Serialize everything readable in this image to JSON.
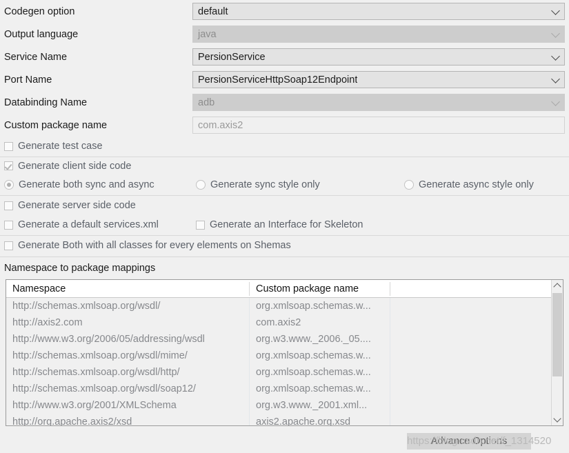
{
  "form": {
    "rows": [
      {
        "label": "Codegen option",
        "value": "default",
        "control": "combo",
        "disabled": false
      },
      {
        "label": "Output language",
        "value": "java",
        "control": "combo",
        "disabled": true
      },
      {
        "label": "Service Name",
        "value": "PersionService",
        "control": "combo",
        "disabled": false
      },
      {
        "label": "Port Name",
        "value": "PersionServiceHttpSoap12Endpoint",
        "control": "combo",
        "disabled": false
      },
      {
        "label": "Databinding Name",
        "value": "adb",
        "control": "combo",
        "disabled": true
      },
      {
        "label": "Custom package name",
        "value": "com.axis2",
        "control": "textfield",
        "disabled": false
      }
    ]
  },
  "options": {
    "test_case": {
      "label": "Generate test case",
      "checked": false
    },
    "client_side": {
      "label": "Generate client side code",
      "checked": true
    },
    "radio_both": {
      "label": "Generate both sync and async",
      "selected": true
    },
    "radio_sync": {
      "label": "Generate sync style only",
      "selected": false
    },
    "radio_async": {
      "label": "Generate async style only",
      "selected": false
    },
    "server_side": {
      "label": "Generate server side code",
      "checked": false
    },
    "services_xml": {
      "label": "Generate a default services.xml",
      "checked": false
    },
    "interface_skel": {
      "label": "Generate an Interface for Skeleton",
      "checked": false
    },
    "both_all_classes": {
      "label": "Generate Both with all classes for every elements on Shemas",
      "checked": false
    }
  },
  "table": {
    "title": "Namespace to package mappings",
    "columns": [
      "Namespace",
      "Custom package name",
      ""
    ],
    "rows": [
      [
        "http://schemas.xmlsoap.org/wsdl/",
        "org.xmlsoap.schemas.w...",
        ""
      ],
      [
        "http://axis2.com",
        "com.axis2",
        ""
      ],
      [
        "http://www.w3.org/2006/05/addressing/wsdl",
        "org.w3.www._2006._05....",
        ""
      ],
      [
        "http://schemas.xmlsoap.org/wsdl/mime/",
        "org.xmlsoap.schemas.w...",
        ""
      ],
      [
        "http://schemas.xmlsoap.org/wsdl/http/",
        "org.xmlsoap.schemas.w...",
        ""
      ],
      [
        "http://schemas.xmlsoap.org/wsdl/soap12/",
        "org.xmlsoap.schemas.w...",
        ""
      ],
      [
        "http://www.w3.org/2001/XMLSchema",
        "org.w3.www._2001.xml...",
        ""
      ],
      [
        "http://org.apache.axis2/xsd",
        "axis2.apache.org.xsd",
        ""
      ]
    ],
    "scrollbar": {
      "up_icon": "chevron-up-icon",
      "down_icon": "chevron-down-icon"
    }
  },
  "footer": {
    "advance_button": "Advance Options",
    "watermark": "https://blog.csdn.net/f_1314520"
  },
  "colors": {
    "page_bg": "#f0f0f0",
    "combo_bg": "#e3e3e3",
    "combo_disabled_bg": "#cdcdcd",
    "label_text": "#1a1a1a",
    "option_text": "#5b6068",
    "table_text": "#86888c",
    "button_bg": "#d4d4d4",
    "watermark_text": "#b9b9b9"
  }
}
